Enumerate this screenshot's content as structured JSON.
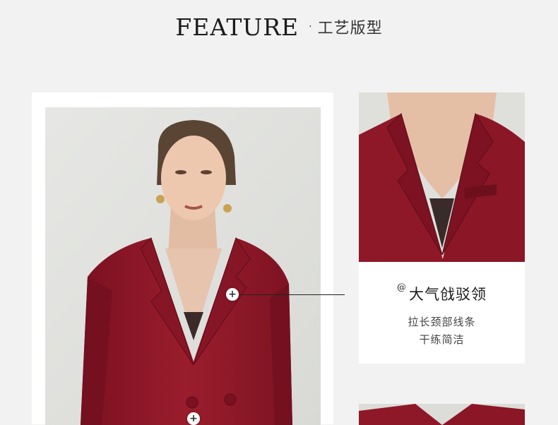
{
  "header": {
    "title_en": "FEATURE",
    "separator": "·",
    "title_cn": "工艺版型"
  },
  "caption": {
    "symbol": "@",
    "title": "大气戗驳领",
    "line1": "拉长颈部线条",
    "line2": "干练简洁"
  },
  "hotspots": {
    "collar": "+",
    "button": "+"
  },
  "colors": {
    "background": "#f2f2f2",
    "suit_red": "#8e1828",
    "card": "#ffffff"
  }
}
